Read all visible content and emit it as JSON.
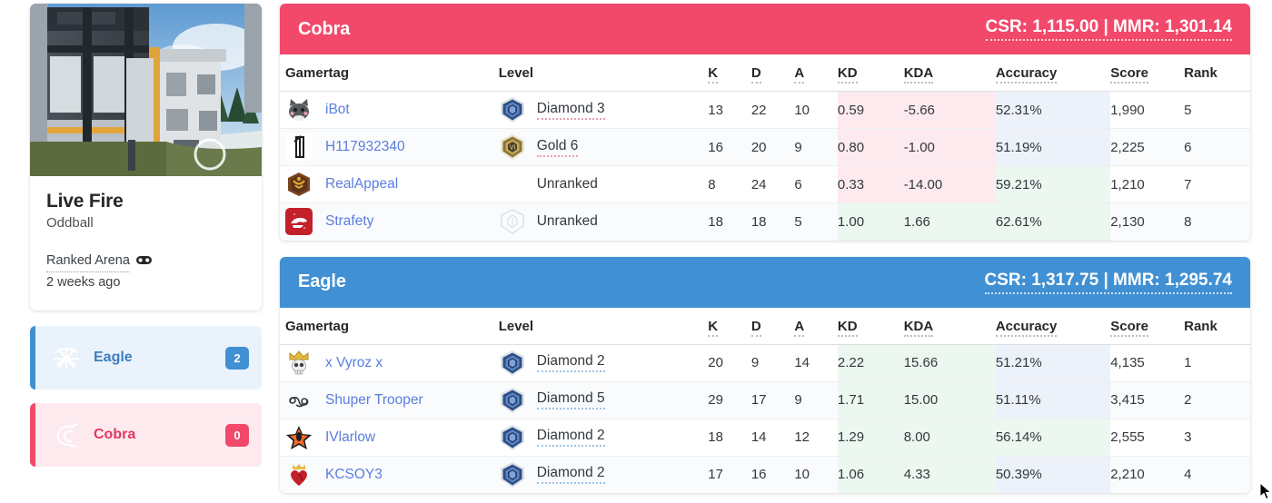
{
  "match_card": {
    "map_name": "Live Fire",
    "mode": "Oddball",
    "playlist": "Ranked Arena",
    "playlist_icon": "gamepad-icon",
    "time_ago": "2 weeks ago"
  },
  "team_selector": [
    {
      "name": "Eagle",
      "score": "2",
      "emblem": "eagle-emblem-icon",
      "color": "#4190d3",
      "selected": true
    },
    {
      "name": "Cobra",
      "score": "0",
      "emblem": "cobra-emblem-icon",
      "color": "#f2496b",
      "selected": false
    }
  ],
  "columns": [
    {
      "key": "gamertag",
      "label": "Gamertag",
      "tooltip": false
    },
    {
      "key": "level",
      "label": "Level",
      "tooltip": false
    },
    {
      "key": "k",
      "label": "K",
      "tooltip": true
    },
    {
      "key": "d",
      "label": "D",
      "tooltip": true
    },
    {
      "key": "a",
      "label": "A",
      "tooltip": true
    },
    {
      "key": "kd",
      "label": "KD",
      "tooltip": true
    },
    {
      "key": "kda",
      "label": "KDA",
      "tooltip": true
    },
    {
      "key": "accuracy",
      "label": "Accuracy",
      "tooltip": true
    },
    {
      "key": "score",
      "label": "Score",
      "tooltip": true
    },
    {
      "key": "rank",
      "label": "Rank",
      "tooltip": false
    }
  ],
  "teams": [
    {
      "id": "cobra",
      "name": "Cobra",
      "accent": "#f2496b",
      "stats_label": "CSR: 1,115.00 | MMR: 1,301.14",
      "csr": "1,115.00",
      "mmr": "1,301.14",
      "players": [
        {
          "avatar": "cat-avatar-icon",
          "gamertag": "iBot",
          "level": "Diamond 3",
          "level_badge": "diamond-badge-icon",
          "k": "13",
          "d": "22",
          "a": "10",
          "kd": "0.59",
          "kd_state": "neg",
          "kda": "-5.66",
          "kda_state": "neg",
          "accuracy": "52.31%",
          "acc_state": "blue",
          "score": "1,990",
          "rank": "5"
        },
        {
          "avatar": "numeral-one-avatar-icon",
          "gamertag": "H117932340",
          "level": "Gold 6",
          "level_badge": "gold-badge-icon",
          "k": "16",
          "d": "20",
          "a": "9",
          "kd": "0.80",
          "kd_state": "neg",
          "kda": "-1.00",
          "kda_state": "neg",
          "accuracy": "51.19%",
          "acc_state": "blue",
          "score": "2,225",
          "rank": "6"
        },
        {
          "avatar": "bronze-crest-avatar-icon",
          "gamertag": "RealAppeal",
          "level": "Unranked",
          "level_badge": "none",
          "k": "8",
          "d": "24",
          "a": "6",
          "kd": "0.33",
          "kd_state": "neg",
          "kda": "-14.00",
          "kda_state": "neg",
          "accuracy": "59.21%",
          "acc_state": "green",
          "score": "1,210",
          "rank": "7"
        },
        {
          "avatar": "red-helmet-avatar-icon",
          "gamertag": "Strafety",
          "level": "Unranked",
          "level_badge": "faded",
          "k": "18",
          "d": "18",
          "a": "5",
          "kd": "1.00",
          "kd_state": "pos",
          "kda": "1.66",
          "kda_state": "pos",
          "accuracy": "62.61%",
          "acc_state": "green",
          "score": "2,130",
          "rank": "8"
        }
      ]
    },
    {
      "id": "eagle",
      "name": "Eagle",
      "accent": "#4190d3",
      "stats_label": "CSR: 1,317.75 | MMR: 1,295.74",
      "csr": "1,317.75",
      "mmr": "1,295.74",
      "players": [
        {
          "avatar": "crown-skull-avatar-icon",
          "gamertag": "x Vyroz x",
          "level": "Diamond 2",
          "level_badge": "diamond-badge-icon",
          "k": "20",
          "d": "9",
          "a": "14",
          "kd": "2.22",
          "kd_state": "pos",
          "kda": "15.66",
          "kda_state": "pos",
          "accuracy": "51.21%",
          "acc_state": "blue",
          "score": "4,135",
          "rank": "1"
        },
        {
          "avatar": "cloud9-avatar-icon",
          "gamertag": "Shuper Trooper",
          "level": "Diamond 5",
          "level_badge": "diamond-badge-icon",
          "k": "29",
          "d": "17",
          "a": "9",
          "kd": "1.71",
          "kd_state": "pos",
          "kda": "15.00",
          "kda_state": "pos",
          "accuracy": "51.11%",
          "acc_state": "blue",
          "score": "3,415",
          "rank": "2"
        },
        {
          "avatar": "orange-star-avatar-icon",
          "gamertag": "IVlarlow",
          "level": "Diamond 2",
          "level_badge": "diamond-badge-icon",
          "k": "18",
          "d": "14",
          "a": "12",
          "kd": "1.29",
          "kd_state": "pos",
          "kda": "8.00",
          "kda_state": "pos",
          "accuracy": "56.14%",
          "acc_state": "green",
          "score": "2,555",
          "rank": "3"
        },
        {
          "avatar": "crowned-heart-avatar-icon",
          "gamertag": "KCSOY3",
          "level": "Diamond 2",
          "level_badge": "diamond-badge-icon",
          "k": "17",
          "d": "16",
          "a": "10",
          "kd": "1.06",
          "kd_state": "pos",
          "kda": "4.33",
          "kda_state": "pos",
          "accuracy": "50.39%",
          "acc_state": "blue",
          "score": "2,210",
          "rank": "4"
        }
      ]
    }
  ]
}
